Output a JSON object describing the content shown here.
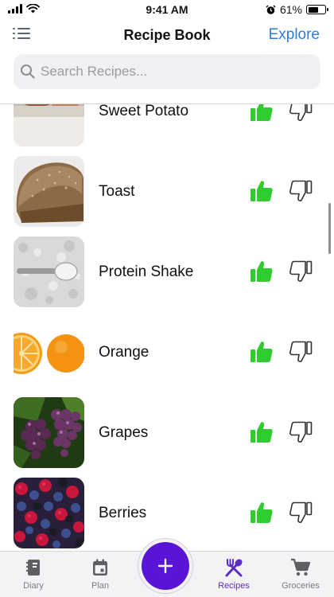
{
  "status_bar": {
    "time": "9:41 AM",
    "battery_percent_label": "61%",
    "battery_level": 0.61
  },
  "nav": {
    "title": "Recipe Book",
    "explore_label": "Explore",
    "menu_icon": "list-icon"
  },
  "search": {
    "placeholder": "Search Recipes...",
    "value": ""
  },
  "recipes": [
    {
      "name": "Sweet Potato",
      "image": "sweet-potato-photo"
    },
    {
      "name": "Toast",
      "image": "bread-loaf-photo"
    },
    {
      "name": "Protein Shake",
      "image": "protein-powder-scoop-photo"
    },
    {
      "name": "Orange",
      "image": "orange-halves-photo"
    },
    {
      "name": "Grapes",
      "image": "purple-grapes-photo"
    },
    {
      "name": "Berries",
      "image": "mixed-berries-photo"
    }
  ],
  "colors": {
    "accent": "#2f7bd8",
    "like": "#2ecc2e",
    "primary": "#5a14d6",
    "active_tab": "#5b2bc9"
  },
  "tabs": [
    {
      "label": "Diary",
      "icon": "diary-icon",
      "active": false
    },
    {
      "label": "Plan",
      "icon": "calendar-icon",
      "active": false
    },
    {
      "label": "Recipes",
      "icon": "fork-spoon-icon",
      "active": true
    },
    {
      "label": "Groceries",
      "icon": "cart-icon",
      "active": false
    }
  ],
  "add_button_icon": "plus-icon"
}
